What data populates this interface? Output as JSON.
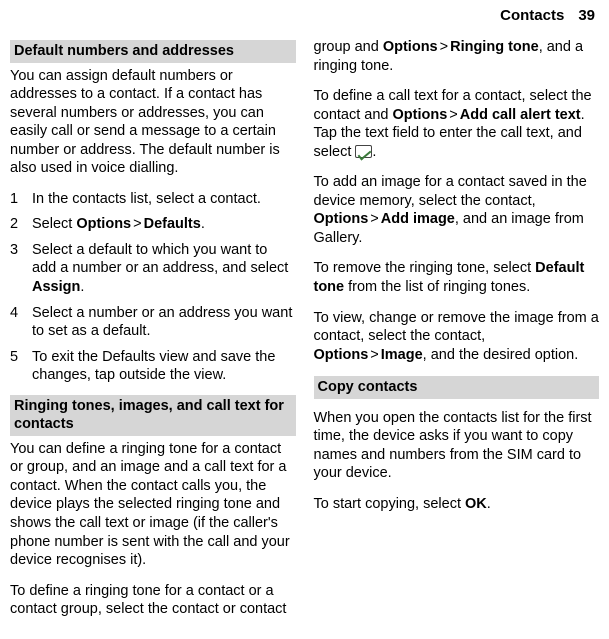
{
  "header": {
    "section": "Contacts",
    "page": "39"
  },
  "sec1": {
    "title": "Default numbers and addresses",
    "intro": "You can assign default numbers or addresses to a contact. If a contact has several numbers or addresses, you can easily call or send a message to a certain number or address. The default number is also used in voice dialling.",
    "steps": {
      "s1": "In the contacts list, select a contact.",
      "s2a": "Select ",
      "s2b": "Options",
      "s2c": "Defaults",
      "s2d": ".",
      "s3a": "Select a default to which you want to add a number or an address, and select ",
      "s3b": "Assign",
      "s3c": ".",
      "s4": "Select a number or an address you want to set as a default.",
      "s5": "To exit the Defaults view and save the changes, tap outside the view."
    }
  },
  "sec2": {
    "title": "Ringing tones, images, and call text for contacts",
    "p1": "You can define a ringing tone for a contact or group, and an image and a call text for a contact. When the contact calls you, the device plays the selected ringing tone and shows the call text or image (if the caller's phone number is sent with the call and your device recognises it).",
    "p2a": "To define a ringing tone for a contact or a contact group, select the contact or contact group and ",
    "p2b": "Options",
    "p2c": "Ringing tone",
    "p2d": ", and a ringing tone.",
    "p3a": "To define a call text for a contact, select the contact and ",
    "p3b": "Options",
    "p3c": "Add call alert text",
    "p3d": ". Tap the text field to enter the call text, and select ",
    "p4a": "To add an image for a contact saved in the device memory, select the contact, ",
    "p4b": "Options",
    "p4c": "Add image",
    "p4d": ", and an image from Gallery.",
    "p5a": "To remove the ringing tone, select ",
    "p5b": "Default tone",
    "p5c": " from the list of ringing tones.",
    "p6a": "To view, change or remove the image from a contact, select the contact, ",
    "p6b": "Options",
    "p6c": "Image",
    "p6d": ", and the desired option."
  },
  "sec3": {
    "title": "Copy contacts",
    "p1": "When you open the contacts list for the first time, the device asks if you want to copy names and numbers from the SIM card to your device.",
    "p2a": "To start copying, select ",
    "p2b": "OK",
    "p2c": "."
  },
  "gt": ">"
}
